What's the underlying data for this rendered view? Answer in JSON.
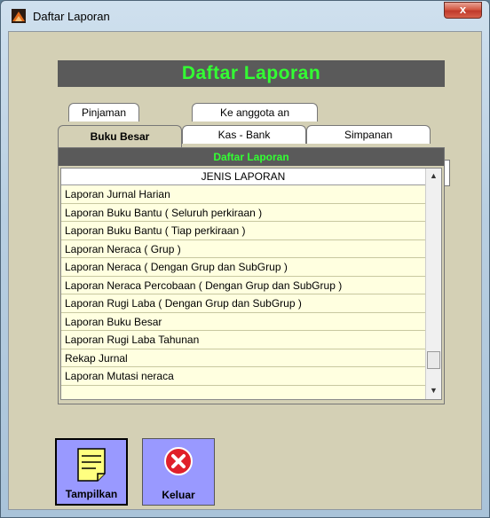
{
  "window": {
    "title": "Daftar Laporan",
    "close_label": "x"
  },
  "banner": {
    "title": "Daftar Laporan"
  },
  "tabs": {
    "row_back": [
      {
        "label": "Pinjaman"
      },
      {
        "label": "Ke anggota an"
      }
    ],
    "row_front": [
      {
        "label": "Buku Besar",
        "active": true
      },
      {
        "label": "Kas - Bank"
      },
      {
        "label": "Simpanan"
      }
    ]
  },
  "panel": {
    "strip_title": "Daftar Laporan",
    "list_header": "JENIS LAPORAN",
    "rows": [
      "Laporan Jurnal Harian",
      "Laporan Buku Bantu ( Seluruh perkiraan )",
      "Laporan Buku Bantu ( Tiap perkiraan )",
      "Laporan Neraca ( Grup )",
      "Laporan Neraca ( Dengan Grup dan SubGrup )",
      "Laporan Neraca Percobaan ( Dengan Grup dan SubGrup )",
      "Laporan Rugi Laba ( Dengan Grup dan SubGrup )",
      "Laporan Buku Besar",
      "Laporan Rugi Laba Tahunan",
      "Rekap Jurnal",
      "Laporan Mutasi neraca"
    ]
  },
  "buttons": {
    "show_label": "Tampilkan",
    "exit_label": "Keluar"
  },
  "colors": {
    "banner_bg": "#5a5a5a",
    "banner_text": "#33ff33",
    "client_bg": "#d4d0b5",
    "list_bg": "#ffffe0",
    "button_bg": "#9999ff"
  }
}
